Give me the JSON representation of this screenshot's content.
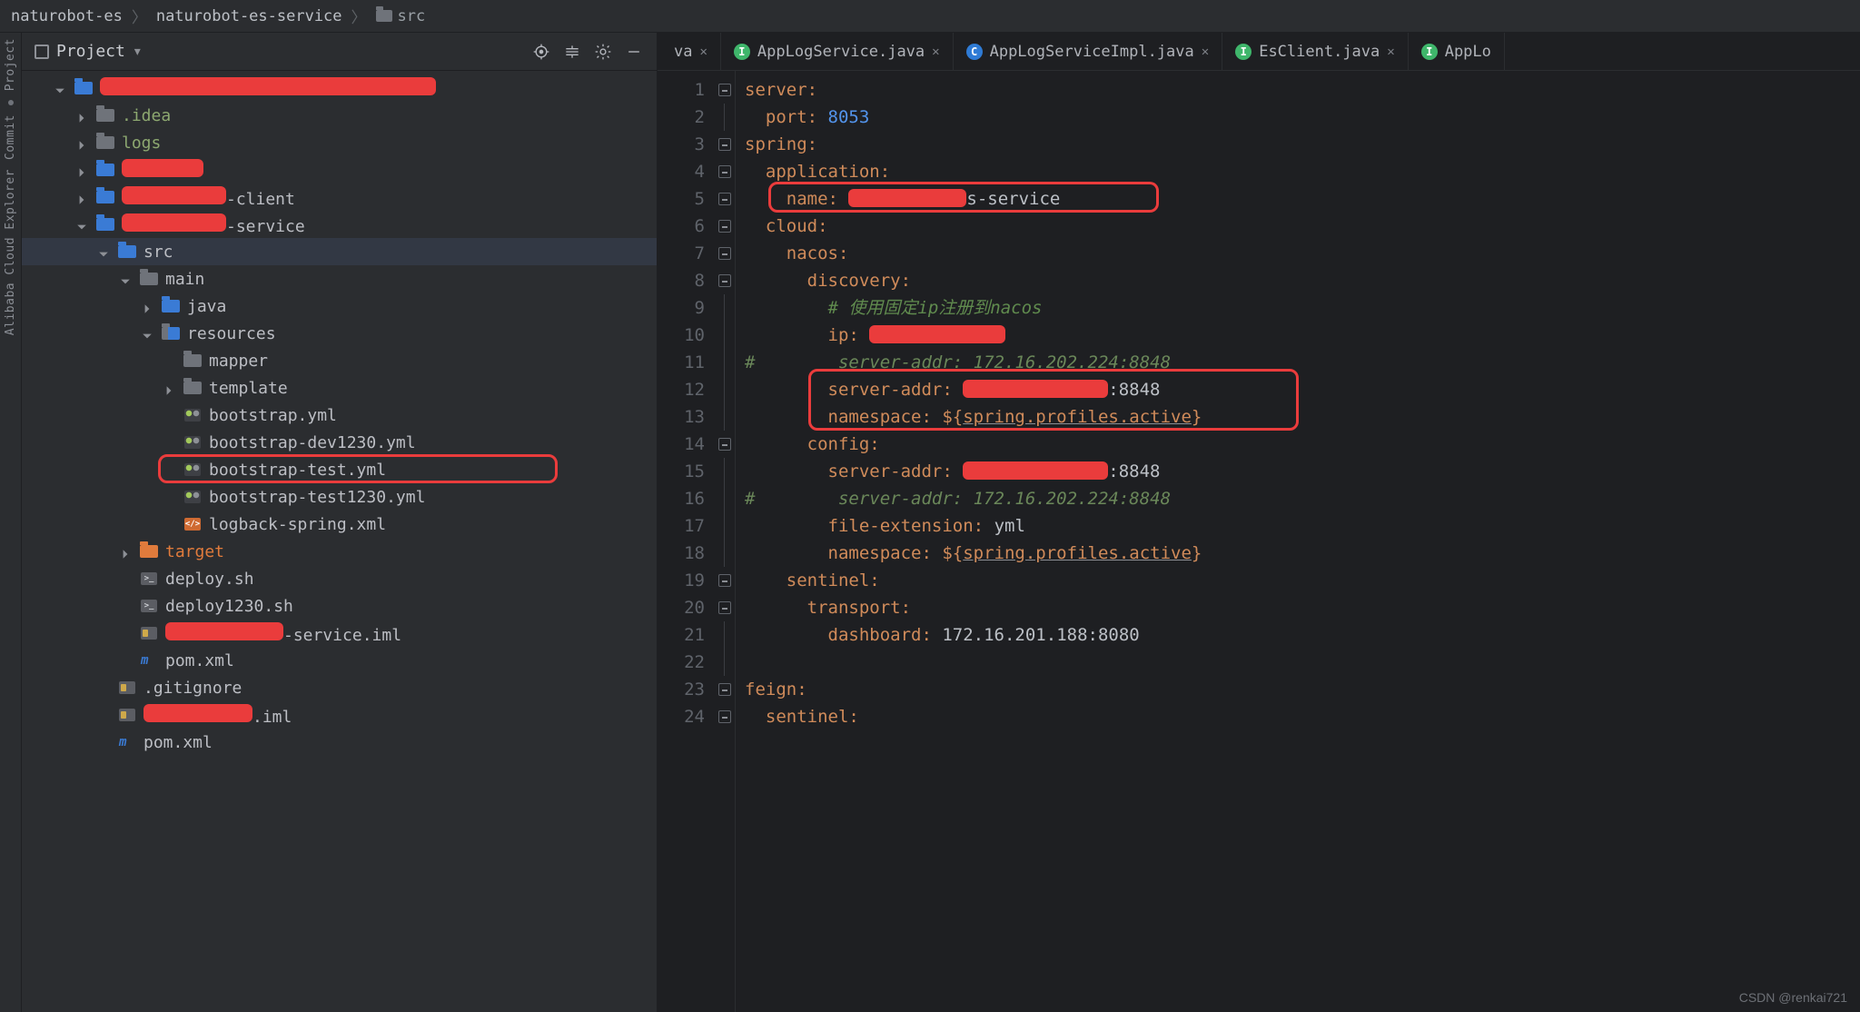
{
  "breadcrumb": {
    "root": "naturobot-es",
    "mid": "naturobot-es-service",
    "leaf": "src"
  },
  "projectHeader": {
    "title": "Project"
  },
  "leftGutter": {
    "labels": [
      "Project",
      "Commit",
      "Alibaba Cloud Explorer"
    ]
  },
  "tree": {
    "items": [
      {
        "ind": 1,
        "arrow": "down",
        "icon": "folder-blue",
        "label": "",
        "redact": 370
      },
      {
        "ind": 2,
        "arrow": "right",
        "icon": "folder",
        "label": ".idea",
        "muted": true
      },
      {
        "ind": 2,
        "arrow": "right",
        "icon": "folder",
        "label": "logs",
        "muted": true
      },
      {
        "ind": 2,
        "arrow": "right",
        "icon": "folder-blue",
        "label": "",
        "redact": 90
      },
      {
        "ind": 2,
        "arrow": "right",
        "icon": "folder-blue",
        "label": "-client",
        "redact": 115,
        "leadRedact": true
      },
      {
        "ind": 2,
        "arrow": "down",
        "icon": "folder-blue",
        "label": "-service",
        "redact": 115,
        "leadRedact": true
      },
      {
        "ind": 3,
        "arrow": "down",
        "icon": "folder-blue",
        "label": "src",
        "sel": true
      },
      {
        "ind": 4,
        "arrow": "down",
        "icon": "folder",
        "label": "main"
      },
      {
        "ind": 5,
        "arrow": "right",
        "icon": "folder-blue",
        "label": "java"
      },
      {
        "ind": 5,
        "arrow": "down",
        "icon": "folder-res",
        "label": "resources"
      },
      {
        "ind": 6,
        "arrow": "",
        "icon": "folder",
        "label": "mapper"
      },
      {
        "ind": 6,
        "arrow": "right",
        "icon": "folder",
        "label": "template"
      },
      {
        "ind": 6,
        "arrow": "",
        "icon": "yaml",
        "label": "bootstrap.yml"
      },
      {
        "ind": 6,
        "arrow": "",
        "icon": "yaml",
        "label": "bootstrap-dev1230.yml"
      },
      {
        "ind": 6,
        "arrow": "",
        "icon": "yaml",
        "label": "bootstrap-test.yml",
        "boxed": true
      },
      {
        "ind": 6,
        "arrow": "",
        "icon": "yaml",
        "label": "bootstrap-test1230.yml"
      },
      {
        "ind": 6,
        "arrow": "",
        "icon": "xml",
        "label": "logback-spring.xml"
      },
      {
        "ind": 4,
        "arrow": "right",
        "icon": "folder-orange",
        "label": "target",
        "tgt": true
      },
      {
        "ind": 4,
        "arrow": "",
        "icon": "sh",
        "label": "deploy.sh"
      },
      {
        "ind": 4,
        "arrow": "",
        "icon": "sh",
        "label": "deploy1230.sh"
      },
      {
        "ind": 4,
        "arrow": "",
        "icon": "iml",
        "label": "-service.iml",
        "redact": 130,
        "leadRedact": true
      },
      {
        "ind": 4,
        "arrow": "",
        "icon": "m",
        "label": "pom.xml"
      },
      {
        "ind": 3,
        "arrow": "",
        "icon": "iml",
        "label": ".gitignore"
      },
      {
        "ind": 3,
        "arrow": "",
        "icon": "iml",
        "label": ".iml",
        "redact": 120,
        "leadRedact": true
      },
      {
        "ind": 3,
        "arrow": "",
        "icon": "m",
        "label": "pom.xml"
      }
    ]
  },
  "tabs": [
    {
      "badge": "",
      "badgeClass": "",
      "name": "va",
      "partial": true
    },
    {
      "badge": "I",
      "badgeClass": "bg-i",
      "name": "AppLogService.java"
    },
    {
      "badge": "C",
      "badgeClass": "bg-c",
      "name": "AppLogServiceImpl.java"
    },
    {
      "badge": "I",
      "badgeClass": "bg-i",
      "name": "EsClient.java"
    },
    {
      "badge": "I",
      "badgeClass": "bg-i",
      "name": "AppLo",
      "partial": true,
      "nocross": true
    }
  ],
  "code": {
    "lines": [
      {
        "n": 1,
        "t": [
          [
            "key",
            "server"
          ],
          [
            "p",
            ":"
          ]
        ]
      },
      {
        "n": 2,
        "t": [
          [
            "sp",
            "  "
          ],
          [
            "key",
            "port"
          ],
          [
            "p",
            ": "
          ],
          [
            "num",
            "8053"
          ]
        ]
      },
      {
        "n": 3,
        "t": [
          [
            "key",
            "spring"
          ],
          [
            "p",
            ":"
          ]
        ]
      },
      {
        "n": 4,
        "t": [
          [
            "sp",
            "  "
          ],
          [
            "key",
            "application"
          ],
          [
            "p",
            ":"
          ]
        ]
      },
      {
        "n": 5,
        "t": [
          [
            "sp",
            "    "
          ],
          [
            "key",
            "name"
          ],
          [
            "p",
            ": "
          ],
          [
            "red",
            130
          ],
          [
            "txt",
            "s-service"
          ]
        ],
        "boxNameLine": true
      },
      {
        "n": 6,
        "t": [
          [
            "sp",
            "  "
          ],
          [
            "key",
            "cloud"
          ],
          [
            "p",
            ":"
          ]
        ]
      },
      {
        "n": 7,
        "t": [
          [
            "sp",
            "    "
          ],
          [
            "key",
            "nacos"
          ],
          [
            "p",
            ":"
          ]
        ]
      },
      {
        "n": 8,
        "t": [
          [
            "sp",
            "      "
          ],
          [
            "key",
            "discovery"
          ],
          [
            "p",
            ":"
          ]
        ]
      },
      {
        "n": 9,
        "t": [
          [
            "sp",
            "        "
          ],
          [
            "cmt2",
            "# 使用固定ip注册到nacos"
          ]
        ]
      },
      {
        "n": 10,
        "t": [
          [
            "sp",
            "        "
          ],
          [
            "key",
            "ip"
          ],
          [
            "p",
            ": "
          ],
          [
            "red",
            150
          ]
        ]
      },
      {
        "n": 11,
        "t": [
          [
            "hash",
            "#"
          ],
          [
            "sp",
            "        "
          ],
          [
            "cmt",
            "server-addr: 172.16.202.224:8848"
          ]
        ]
      },
      {
        "n": 12,
        "t": [
          [
            "sp",
            "        "
          ],
          [
            "key",
            "server-addr"
          ],
          [
            "p",
            ": "
          ],
          [
            "red",
            160
          ],
          [
            "txt",
            ":8848"
          ]
        ]
      },
      {
        "n": 13,
        "t": [
          [
            "sp",
            "        "
          ],
          [
            "key",
            "namespace"
          ],
          [
            "p",
            ": ${"
          ],
          [
            "var",
            "spring.profiles.active"
          ],
          [
            "p",
            "}"
          ]
        ]
      },
      {
        "n": 14,
        "t": [
          [
            "sp",
            "      "
          ],
          [
            "key",
            "config"
          ],
          [
            "p",
            ":"
          ]
        ]
      },
      {
        "n": 15,
        "t": [
          [
            "sp",
            "        "
          ],
          [
            "key",
            "server-addr"
          ],
          [
            "p",
            ": "
          ],
          [
            "red",
            160
          ],
          [
            "txt",
            ":8848"
          ]
        ]
      },
      {
        "n": 16,
        "t": [
          [
            "hash",
            "#"
          ],
          [
            "sp",
            "        "
          ],
          [
            "cmt",
            "server-addr: 172.16.202.224:8848"
          ]
        ]
      },
      {
        "n": 17,
        "t": [
          [
            "sp",
            "        "
          ],
          [
            "key",
            "file-extension"
          ],
          [
            "p",
            ": "
          ],
          [
            "txt",
            "yml"
          ]
        ]
      },
      {
        "n": 18,
        "t": [
          [
            "sp",
            "        "
          ],
          [
            "key",
            "namespace"
          ],
          [
            "p",
            ": ${"
          ],
          [
            "var",
            "spring.profiles.active"
          ],
          [
            "p",
            "}"
          ]
        ]
      },
      {
        "n": 19,
        "t": [
          [
            "sp",
            "    "
          ],
          [
            "key",
            "sentinel"
          ],
          [
            "p",
            ":"
          ]
        ]
      },
      {
        "n": 20,
        "t": [
          [
            "sp",
            "      "
          ],
          [
            "key",
            "transport"
          ],
          [
            "p",
            ":"
          ]
        ]
      },
      {
        "n": 21,
        "t": [
          [
            "sp",
            "        "
          ],
          [
            "key",
            "dashboard"
          ],
          [
            "p",
            ": "
          ],
          [
            "txt",
            "172.16.201.188:8080"
          ]
        ]
      },
      {
        "n": 22,
        "t": []
      },
      {
        "n": 23,
        "t": [
          [
            "key",
            "feign"
          ],
          [
            "p",
            ":"
          ]
        ]
      },
      {
        "n": 24,
        "t": [
          [
            "sp",
            "  "
          ],
          [
            "key",
            "sentinel"
          ],
          [
            "p",
            ":"
          ]
        ]
      }
    ],
    "boxServerAddr": {
      "fromLine": 12,
      "toLine": 13
    }
  },
  "watermark": "CSDN @renkai721"
}
